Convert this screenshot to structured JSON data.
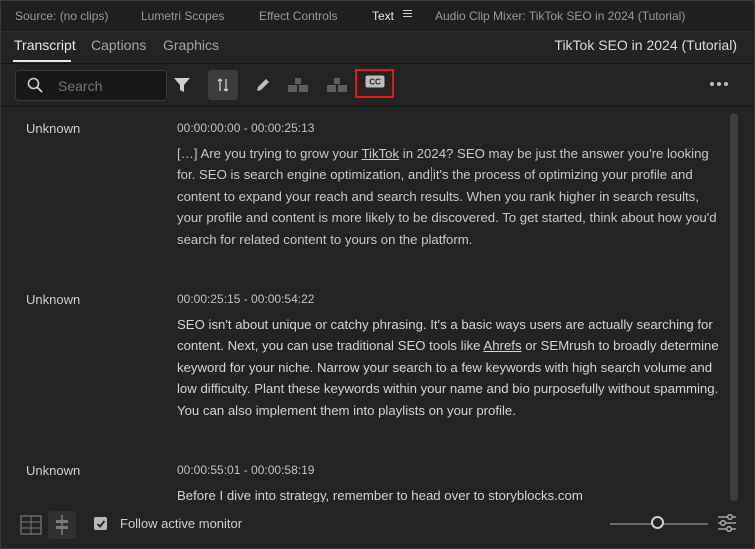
{
  "panel_tabs": [
    {
      "label": "Source: (no clips)"
    },
    {
      "label": "Lumetri Scopes"
    },
    {
      "label": "Effect Controls"
    },
    {
      "label": "Text"
    },
    {
      "label": "Audio Clip Mixer: TikTok SEO in 2024 (Tutorial)"
    }
  ],
  "sub_tabs": [
    {
      "label": "Transcript"
    },
    {
      "label": "Captions"
    },
    {
      "label": "Graphics"
    }
  ],
  "sequence_title": "TikTok SEO in 2024 (Tutorial)",
  "search": {
    "placeholder": "Search",
    "value": ""
  },
  "toolbar_icons": [
    "filter-icon",
    "merge-segments-icon",
    "edit-icon",
    "split-segment-icon",
    "merge-icon",
    "closed-captions-icon"
  ],
  "segments": [
    {
      "speaker": "Unknown",
      "timecode": "00:00:00:00 - 00:00:25:13",
      "text_parts": {
        "a": "[…] Are you trying to grow your ",
        "b": "TikTok",
        "c": " in 2024? SEO may be just the answer you're looking for. SEO is search engine optimization, and",
        "d": "it's the process of optimizing your profile and content to expand your reach and search results. When you rank higher in search results, your profile and content is more likely to be discovered. To get started, think about how you'd search for related content to yours on the platform."
      }
    },
    {
      "speaker": "Unknown",
      "timecode": "00:00:25:15 - 00:00:54:22",
      "text_parts": {
        "a": "SEO isn't about unique or catchy phrasing. It's a basic ways users are actually searching for content. Next, you can use traditional SEO tools like ",
        "b": "Ahrefs",
        "c": " or SEMrush to broadly determine keyword for your niche. Narrow your search to a few keywords with high search volume and low difficulty. Plant these keywords within your name and bio purposefully without spamming. You can also implement them into playlists on your profile."
      }
    },
    {
      "speaker": "Unknown",
      "timecode": "00:00:55:01 - 00:00:58:19",
      "text": "Before I dive into strategy, remember to head over to storyblocks.com"
    }
  ],
  "footer": {
    "follow_label": "Follow active monitor",
    "follow_checked": true,
    "zoom_level": 0.5
  },
  "colors": {
    "highlight_border": "#e21a1a",
    "cursor": "#5aa0ff"
  }
}
